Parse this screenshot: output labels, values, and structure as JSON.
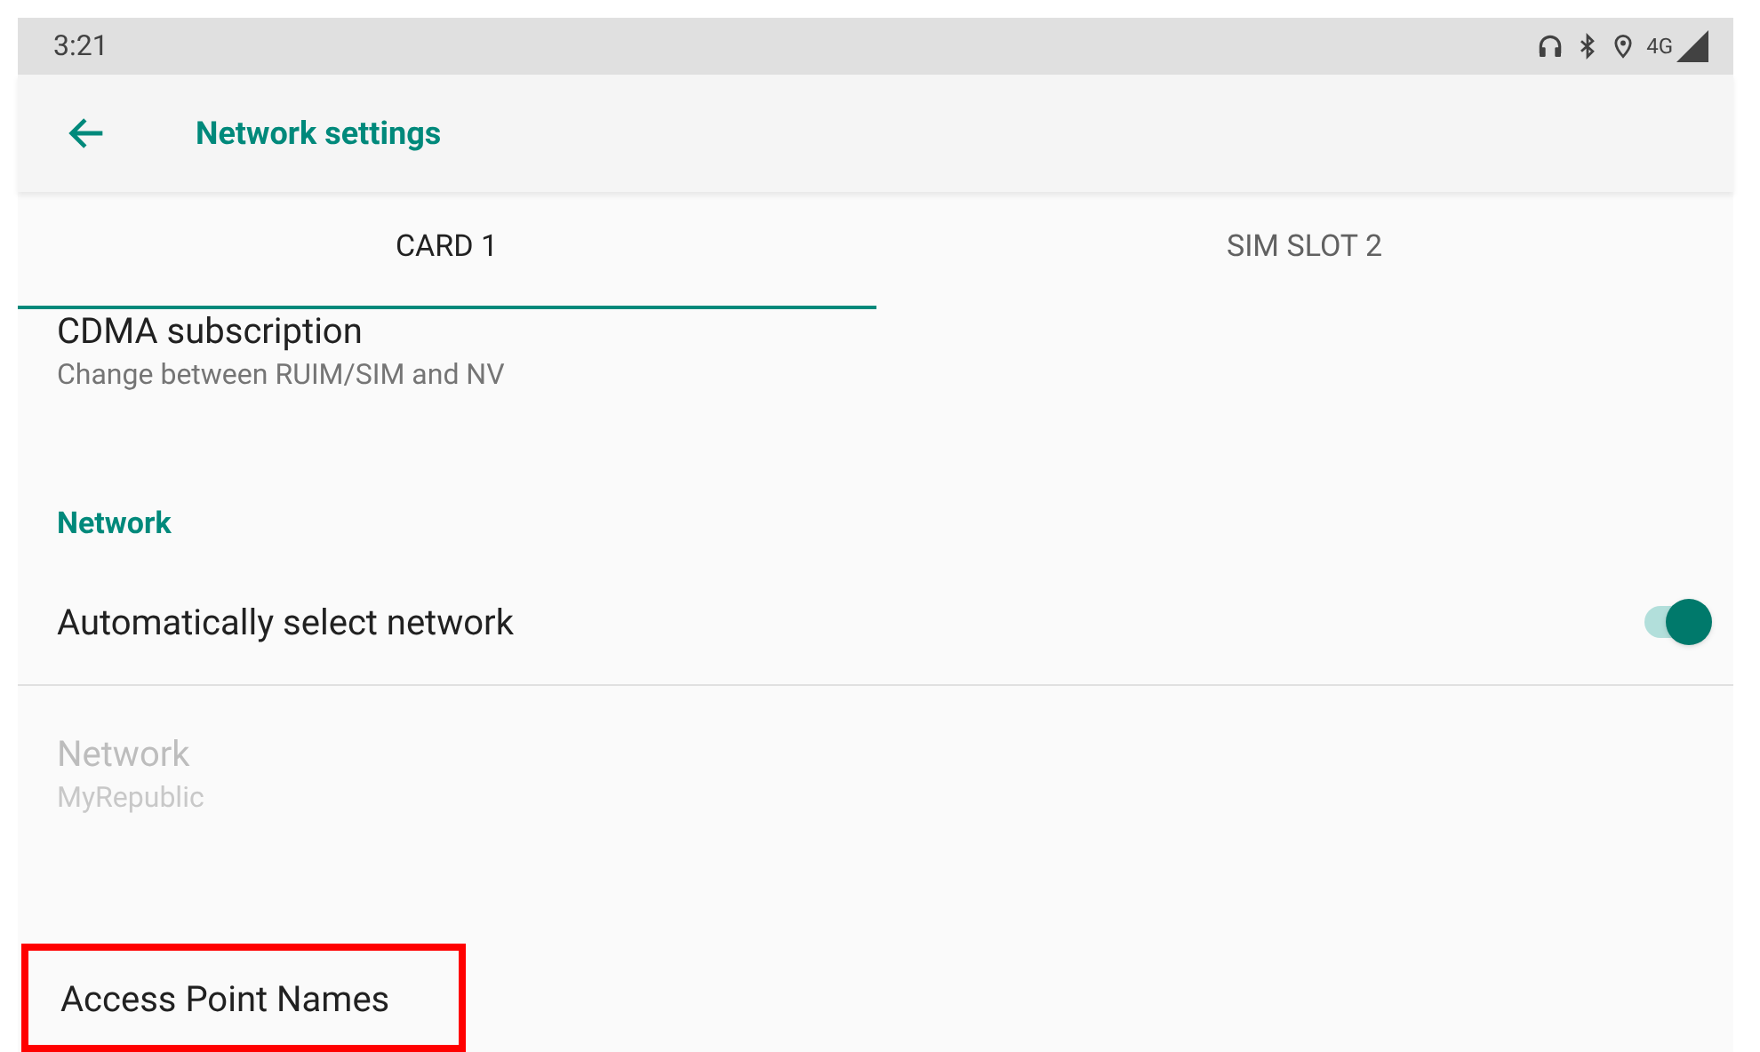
{
  "status_bar": {
    "time": "3:21",
    "network_type": "4G"
  },
  "app_bar": {
    "title": "Network settings"
  },
  "tabs": [
    {
      "label": "CARD 1",
      "selected": true
    },
    {
      "label": "SIM SLOT 2",
      "selected": false
    }
  ],
  "items": [
    {
      "kind": "item",
      "title": "CDMA subscription",
      "summary": "Change between RUIM/SIM and NV",
      "disabled": false,
      "highlighted": false
    },
    {
      "kind": "category",
      "title": "Network"
    },
    {
      "kind": "switch",
      "title": "Automatically select network",
      "on": true
    },
    {
      "kind": "item",
      "title": "Network",
      "summary": "MyRepublic",
      "disabled": true,
      "highlighted": false
    },
    {
      "kind": "item",
      "title": "Access Point Names",
      "disabled": false,
      "highlighted": true
    }
  ]
}
